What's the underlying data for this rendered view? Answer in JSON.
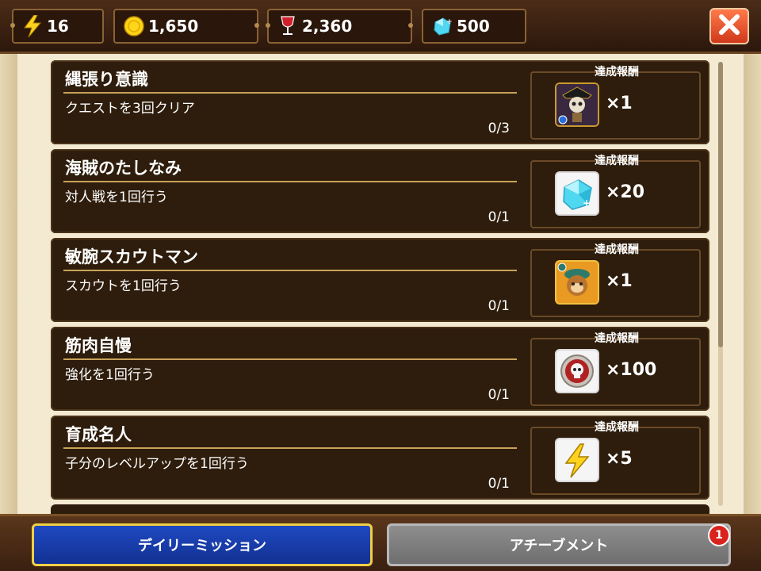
{
  "resources": {
    "energy": "16",
    "coins": "1,650",
    "wine": "2,360",
    "gems": "500"
  },
  "missions": [
    {
      "title": "縄張り意識",
      "desc": "クエストを3回クリア",
      "progress": "0/3",
      "reward_label": "達成報酬",
      "reward_icon": "skeleton-captain-icon",
      "reward_qty": "×1"
    },
    {
      "title": "海賊のたしなみ",
      "desc": "対人戦を1回行う",
      "progress": "0/1",
      "reward_label": "達成報酬",
      "reward_icon": "gem-icon",
      "reward_qty": "×20"
    },
    {
      "title": "敏腕スカウトマン",
      "desc": "スカウトを1回行う",
      "progress": "0/1",
      "reward_label": "達成報酬",
      "reward_icon": "monkey-pirate-icon",
      "reward_qty": "×1"
    },
    {
      "title": "筋肉自慢",
      "desc": "強化を1回行う",
      "progress": "0/1",
      "reward_label": "達成報酬",
      "reward_icon": "skull-coin-icon",
      "reward_qty": "×100"
    },
    {
      "title": "育成名人",
      "desc": "子分のレベルアップを1回行う",
      "progress": "0/1",
      "reward_label": "達成報酬",
      "reward_icon": "lightning-icon",
      "reward_qty": "×5"
    }
  ],
  "tabs": {
    "daily": "デイリーミッション",
    "achievement": "アチーブメント",
    "achievement_badge": "1"
  }
}
